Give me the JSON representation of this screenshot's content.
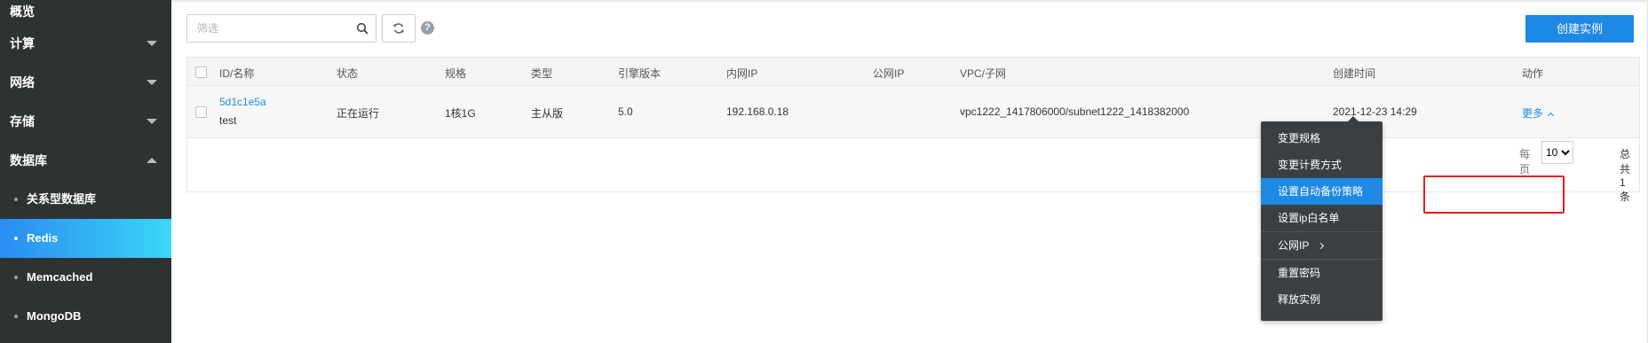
{
  "sidebar": {
    "items": [
      {
        "label": "概览"
      },
      {
        "label": "计算"
      },
      {
        "label": "网络"
      },
      {
        "label": "存储"
      },
      {
        "label": "数据库"
      }
    ],
    "sub_items": [
      {
        "label": "关系型数据库"
      },
      {
        "label": "Redis"
      },
      {
        "label": "Memcached"
      },
      {
        "label": "MongoDB"
      }
    ]
  },
  "toolbar": {
    "filter_placeholder": "筛选",
    "help_label": "?",
    "create_label": "创建实例"
  },
  "table": {
    "headers": {
      "id": "ID/名称",
      "status": "状态",
      "spec": "规格",
      "type": "类型",
      "engine": "引擎版本",
      "private_ip": "内网IP",
      "public_ip": "公网IP",
      "vpc": "VPC/子网",
      "created": "创建时间",
      "actions": "动作"
    },
    "rows": [
      {
        "id": "5d1c1e5a",
        "name": "test",
        "status": "正在运行",
        "spec": "1核1G",
        "type": "主从版",
        "engine": "5.0",
        "private_ip": "192.168.0.18",
        "public_ip": "",
        "vpc": "vpc1222_1417806000/subnet1222_1418382000",
        "created": "2021-12-23 14:29",
        "action": "更多"
      }
    ]
  },
  "pager": {
    "per_page_label": "每页",
    "per_page_value": "10",
    "total": "总共 1 条"
  },
  "action_menu": {
    "items": [
      {
        "label": "变更规格"
      },
      {
        "label": "变更计费方式"
      },
      {
        "label": "设置自动备份策略"
      },
      {
        "label": "设置ip白名单"
      },
      {
        "label": "公网IP"
      },
      {
        "label": "重置密码"
      },
      {
        "label": "释放实例"
      }
    ]
  },
  "colors": {
    "sidebar_bg": "#2f3233",
    "active_gradient_start": "#2a8cf2",
    "active_gradient_end": "#3ad7f7",
    "primary": "#1e88e5",
    "menu_bg": "#3b3f42",
    "annotation": "#e02020"
  }
}
